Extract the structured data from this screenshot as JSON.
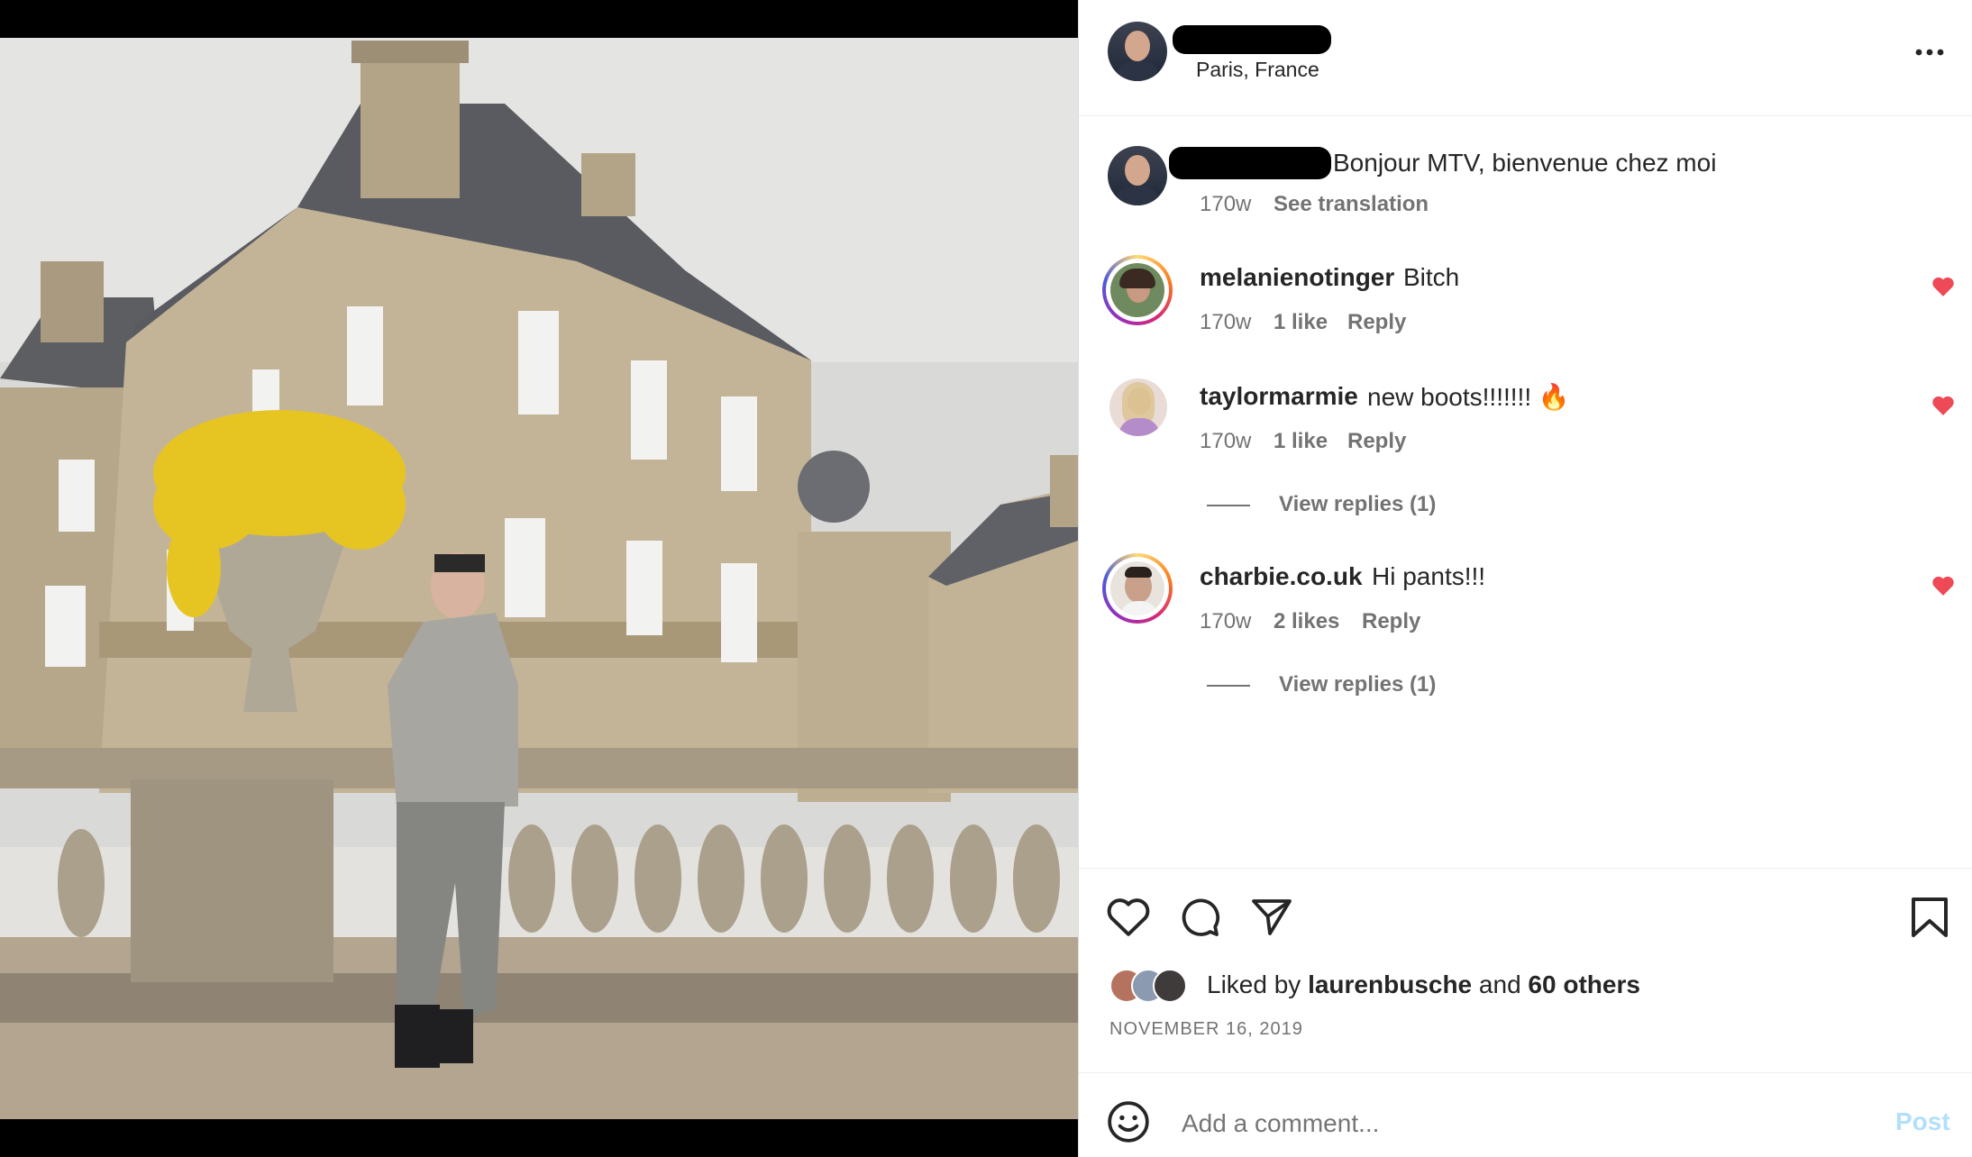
{
  "post": {
    "location": "Paris, France",
    "caption": "Bonjour MTV, bienvenue chez moi",
    "caption_age": "170w",
    "see_translation": "See translation",
    "more_icon": "more-horizontal-icon"
  },
  "comments": [
    {
      "username": "melanienotinger",
      "text": "Bitch",
      "age": "170w",
      "likes": "1 like",
      "reply": "Reply",
      "liked": true
    },
    {
      "username": "taylormarmie",
      "text": "new boots!!!!!!! 🔥",
      "age": "170w",
      "likes": "1 like",
      "reply": "Reply",
      "liked": true,
      "view_replies": "View replies (1)"
    },
    {
      "username": "charbie.co.uk",
      "text": "Hi pants!!!",
      "age": "170w",
      "likes": "2 likes",
      "reply": "Reply",
      "liked": true,
      "view_replies": "View replies (1)"
    }
  ],
  "actions": {
    "like_icon": "heart-icon",
    "comment_icon": "comment-icon",
    "share_icon": "share-icon",
    "save_icon": "bookmark-icon"
  },
  "likes": {
    "prefix": "Liked by",
    "user": "laurenbusche",
    "and": "and",
    "others": "60 others"
  },
  "date": "NOVEMBER 16, 2019",
  "composer": {
    "placeholder": "Add a comment...",
    "post_label": "Post",
    "emoji_icon": "emoji-icon"
  },
  "colors": {
    "heart_red": "#ed4956",
    "post_blue": "#b2dffc",
    "muted": "#737373"
  }
}
